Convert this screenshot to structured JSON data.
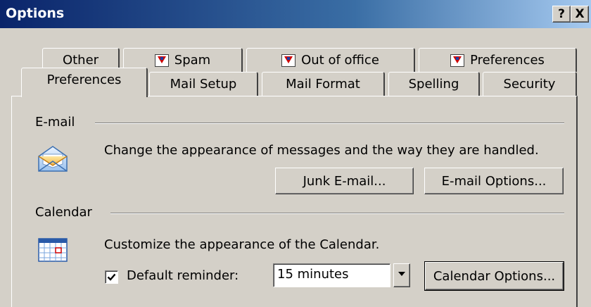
{
  "window": {
    "title": "Options",
    "help_button": "?",
    "close_button": "X"
  },
  "tabs_row1": [
    {
      "label": "Other",
      "icon": ""
    },
    {
      "label": "Spam",
      "icon": "addin-flag-icon"
    },
    {
      "label": "Out of office",
      "icon": "addin-flag-icon"
    },
    {
      "label": "Preferences",
      "icon": "addin-flag-icon"
    }
  ],
  "tabs_row2": [
    {
      "label": "Preferences",
      "active": true
    },
    {
      "label": "Mail Setup"
    },
    {
      "label": "Mail Format"
    },
    {
      "label": "Spelling"
    },
    {
      "label": "Security"
    }
  ],
  "email": {
    "section_label": "E-mail",
    "icon": "envelope-icon",
    "description": "Change the appearance of messages and the way they are handled.",
    "junk_button": "Junk E-mail...",
    "options_button": "E-mail Options..."
  },
  "calendar": {
    "section_label": "Calendar",
    "icon": "calendar-icon",
    "description": "Customize the appearance of the Calendar.",
    "reminder_checked": true,
    "reminder_label": "Default reminder:",
    "reminder_value": "15 minutes",
    "options_button": "Calendar Options..."
  },
  "colors": {
    "face": "#d4d0c8",
    "title_gradient_start": "#0a246a",
    "title_gradient_end": "#a6caf0"
  }
}
